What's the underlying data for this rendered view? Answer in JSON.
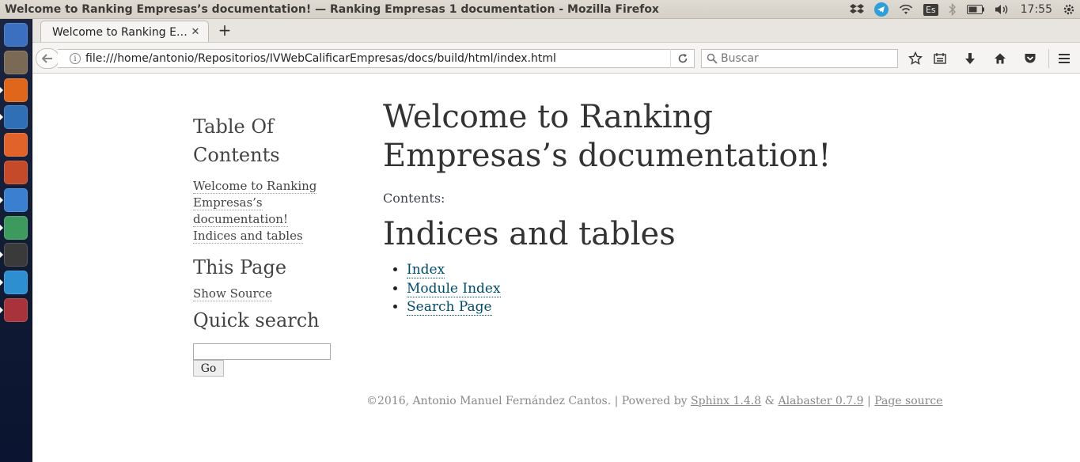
{
  "window": {
    "title": "Welcome to Ranking Empresas’s documentation! — Ranking Empresas 1 documentation - Mozilla Firefox"
  },
  "tray": {
    "keyboard_layout": "Es",
    "clock": "17:55",
    "icons": [
      "dropbox-icon",
      "telegram-icon",
      "wifi-icon",
      "keyboard-layout-icon",
      "bluetooth-icon",
      "battery-icon",
      "volume-icon",
      "settings-gear-icon"
    ]
  },
  "launcher": {
    "items": [
      {
        "name": "ubuntu-dash-icon",
        "color": "#3b6fc0"
      },
      {
        "name": "files-icon",
        "color": "#7a6a55"
      },
      {
        "name": "firefox-icon",
        "color": "#e0661b"
      },
      {
        "name": "libreoffice-writer-icon",
        "color": "#2f6fb5"
      },
      {
        "name": "software-center-icon",
        "color": "#e2632a"
      },
      {
        "name": "system-settings-icon",
        "color": "#c44a2a"
      },
      {
        "name": "chromium-icon",
        "color": "#3a7fd0"
      },
      {
        "name": "atom-icon",
        "color": "#3c9a5e"
      },
      {
        "name": "terminal-icon",
        "color": "#3a3a3a"
      },
      {
        "name": "telegram-launcher-icon",
        "color": "#2d8fd0"
      },
      {
        "name": "archive-manager-icon",
        "color": "#a8333a"
      }
    ]
  },
  "browser": {
    "tab_title": "Welcome to Ranking E…",
    "url": "file:///home/antonio/Repositorios/IVWebCalificarEmpresas/docs/build/html/index.html",
    "search_placeholder": "Buscar"
  },
  "sidebar": {
    "toc_heading": "Table Of Contents",
    "toc_items": [
      "Welcome to Ranking Empresas’s documentation!",
      "Indices and tables"
    ],
    "this_page_heading": "This Page",
    "show_source": "Show Source",
    "quick_search_heading": "Quick search",
    "go_button": "Go"
  },
  "main": {
    "title": "Welcome to Ranking Empresas’s documentation!",
    "contents_label": "Contents:",
    "indices_heading": "Indices and tables",
    "links": [
      "Index",
      "Module Index",
      "Search Page"
    ]
  },
  "footer": {
    "copyright": "©2016, Antonio Manuel Fernández Cantos.",
    "sep1": " | Powered by ",
    "sphinx": "Sphinx 1.4.8",
    "amp": " & ",
    "alabaster": "Alabaster 0.7.9",
    "sep2": " | ",
    "page_source": "Page source"
  }
}
